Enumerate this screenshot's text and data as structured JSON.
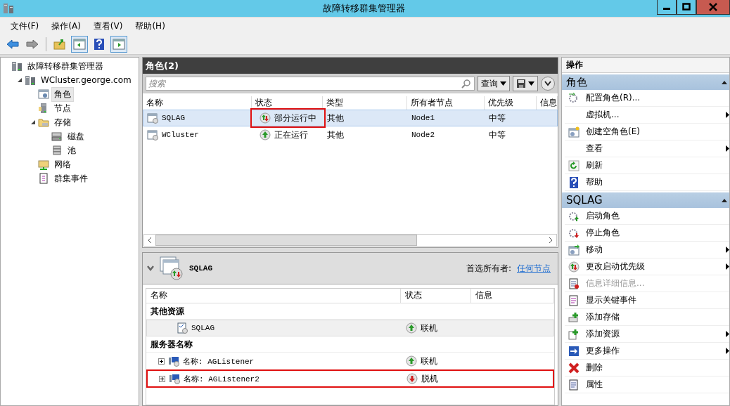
{
  "window": {
    "title": "故障转移群集管理器"
  },
  "menu": [
    "文件(F)",
    "操作(A)",
    "查看(V)",
    "帮助(H)"
  ],
  "tree": [
    {
      "label": "故障转移群集管理器",
      "kind": "cluster",
      "selected": false,
      "children": [
        {
          "label": "WCluster.george.com",
          "kind": "cluster",
          "selected": false,
          "expanded": true,
          "children": [
            {
              "label": "角色",
              "kind": "roles",
              "selected": true
            },
            {
              "label": "节点",
              "kind": "nodes",
              "selected": false
            },
            {
              "label": "存储",
              "kind": "folder",
              "selected": false,
              "expanded": true,
              "children": [
                {
                  "label": "磁盘",
                  "kind": "disk",
                  "selected": false
                },
                {
                  "label": "池",
                  "kind": "pool",
                  "selected": false
                }
              ]
            },
            {
              "label": "网络",
              "kind": "network",
              "selected": false
            },
            {
              "label": "群集事件",
              "kind": "events",
              "selected": false
            }
          ]
        }
      ]
    }
  ],
  "roles": {
    "title": "角色(2)",
    "search": {
      "placeholder": "搜索"
    },
    "query_button": "查询",
    "columns": [
      "名称",
      "状态",
      "类型",
      "所有者节点",
      "优先级",
      "信息"
    ],
    "rows": [
      {
        "name": "SQLAG",
        "status": "部分运行中",
        "kind": "partial",
        "type": "其他",
        "owner": "Node1",
        "priority": "中等",
        "selected": true,
        "highlighted": true
      },
      {
        "name": "WCluster",
        "status": "正在运行",
        "kind": "running",
        "type": "其他",
        "owner": "Node2",
        "priority": "中等",
        "selected": false,
        "highlighted": false
      }
    ]
  },
  "detail": {
    "title": "SQLAG",
    "owner_label": "首选所有者:",
    "owner_link": "任何节点",
    "columns": [
      "名称",
      "状态",
      "信息"
    ],
    "groups": [
      {
        "title": "其他资源",
        "items": [
          {
            "name": "SQLAG",
            "status": "联机",
            "kind": "online",
            "selected": true,
            "highlighted": false,
            "expandable": false
          }
        ]
      },
      {
        "title": "服务器名称",
        "items": [
          {
            "name": "名称: AGListener",
            "status": "联机",
            "kind": "online",
            "selected": false,
            "highlighted": false,
            "expandable": true
          },
          {
            "name": "名称: AGListener2",
            "status": "脱机",
            "kind": "offline",
            "selected": false,
            "highlighted": true,
            "expandable": true
          }
        ]
      }
    ]
  },
  "actions": {
    "title": "操作",
    "sections": [
      {
        "title": "角色",
        "expanded": true,
        "items": [
          {
            "label": "配置角色(R)...",
            "kind": "config",
            "submenu": false,
            "disabled": false
          },
          {
            "label": "虚拟机...",
            "kind": "none",
            "submenu": true,
            "disabled": false
          },
          {
            "label": "创建空角色(E)",
            "kind": "create",
            "submenu": false,
            "disabled": false
          },
          {
            "label": "查看",
            "kind": "none",
            "submenu": true,
            "disabled": false
          },
          {
            "label": "刷新",
            "kind": "refresh",
            "submenu": false,
            "disabled": false
          },
          {
            "label": "帮助",
            "kind": "help",
            "submenu": false,
            "disabled": false
          }
        ]
      },
      {
        "title": "SQLAG",
        "expanded": true,
        "items": [
          {
            "label": "启动角色",
            "kind": "start",
            "submenu": false,
            "disabled": false
          },
          {
            "label": "停止角色",
            "kind": "stop",
            "submenu": false,
            "disabled": false
          },
          {
            "label": "移动",
            "kind": "move",
            "submenu": true,
            "disabled": false
          },
          {
            "label": "更改启动优先级",
            "kind": "priority",
            "submenu": true,
            "disabled": false
          },
          {
            "label": "信息详细信息...",
            "kind": "details",
            "submenu": false,
            "disabled": true
          },
          {
            "label": "显示关键事件",
            "kind": "events",
            "submenu": false,
            "disabled": false
          },
          {
            "label": "添加存储",
            "kind": "addstorage",
            "submenu": false,
            "disabled": false
          },
          {
            "label": "添加资源",
            "kind": "addresource",
            "submenu": true,
            "disabled": false
          },
          {
            "label": "更多操作",
            "kind": "more",
            "submenu": true,
            "disabled": false
          },
          {
            "label": "删除",
            "kind": "delete",
            "submenu": false,
            "disabled": false
          },
          {
            "label": "属性",
            "kind": "properties",
            "submenu": false,
            "disabled": false
          }
        ]
      }
    ]
  }
}
